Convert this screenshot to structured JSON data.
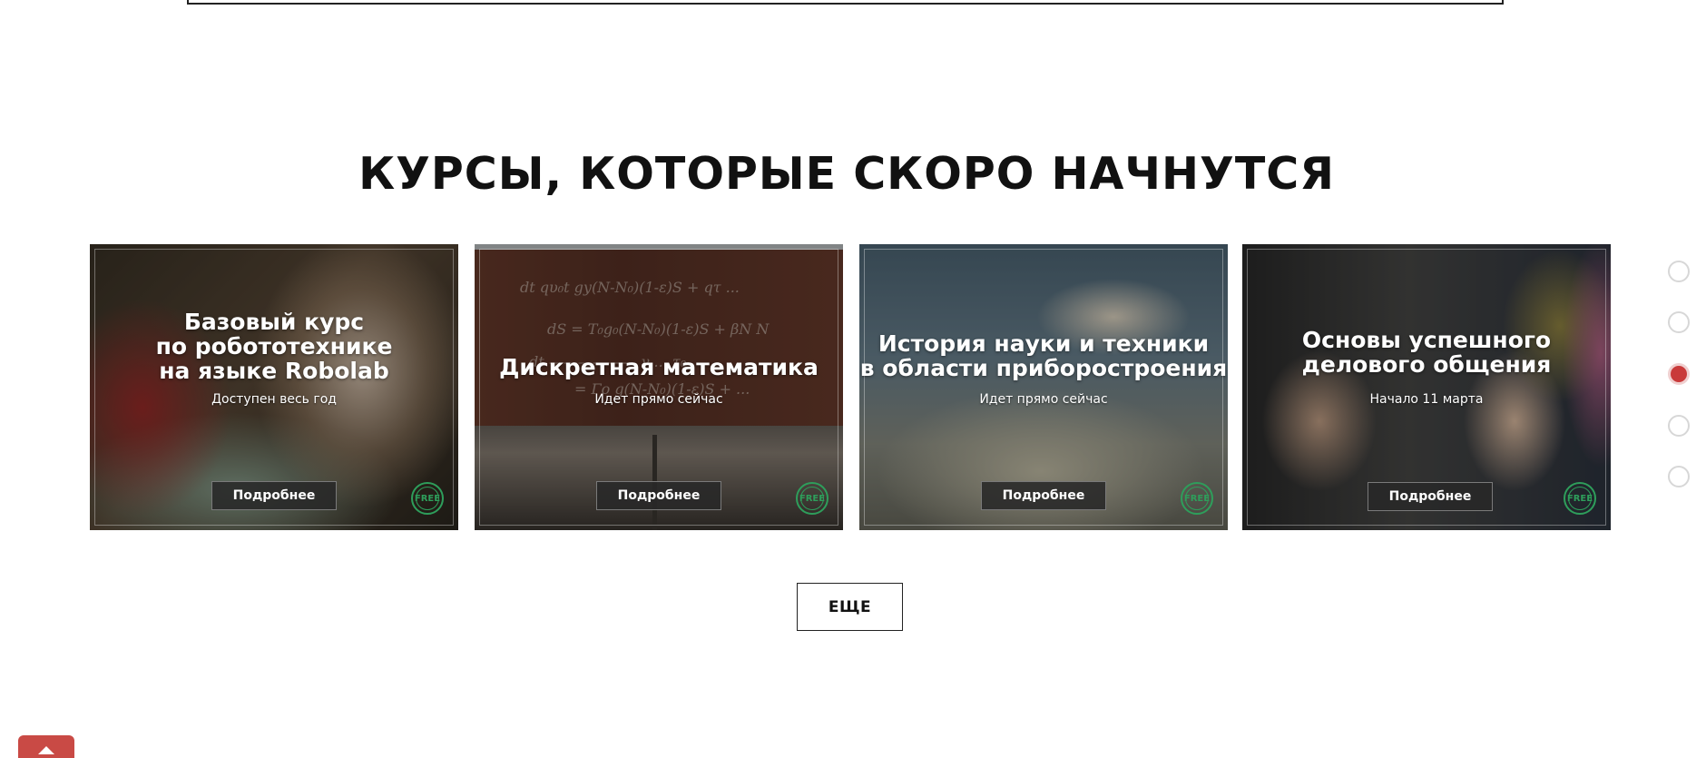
{
  "section": {
    "title": "КУРСЫ, КОТОРЫЕ СКОРО НАЧНУТСЯ",
    "more_label": "ЕЩЕ"
  },
  "courses": [
    {
      "title": "Базовый курс\nпо робототехнике\nна языке Robolab",
      "status": "Доступен весь год",
      "button": "Подробнее",
      "badge": "FREE"
    },
    {
      "title": "Дискретная математика",
      "status": "Идет прямо сейчас",
      "button": "Подробнее",
      "badge": "FREE"
    },
    {
      "title": "История науки и техники\nв области приборостроения",
      "status": "Идет прямо сейчас",
      "button": "Подробнее",
      "badge": "FREE"
    },
    {
      "title": "Основы успешного\nделового общения",
      "status": "Начало 11 марта",
      "button": "Подробнее",
      "badge": "FREE"
    }
  ],
  "section_nav": {
    "count": 5,
    "active_index": 2
  },
  "colors": {
    "accent": "#c93a3a",
    "badge_green": "#2e9e5b"
  },
  "icons": {
    "scroll_top": "arrow-up-icon",
    "badge": "free-badge-icon"
  }
}
